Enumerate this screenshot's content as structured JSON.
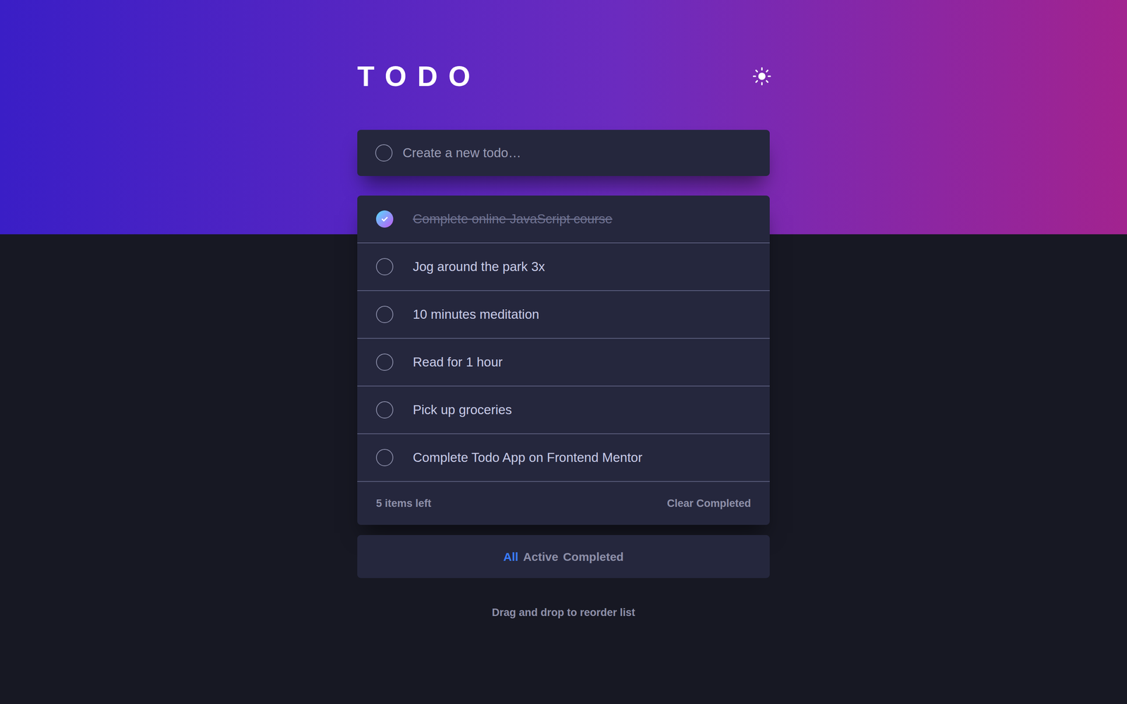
{
  "header": {
    "title": "TODO"
  },
  "new_todo": {
    "placeholder": "Create a new todo…"
  },
  "todos": [
    {
      "text": "Complete online JavaScript course",
      "completed": true
    },
    {
      "text": "Jog around the park 3x",
      "completed": false
    },
    {
      "text": "10 minutes meditation",
      "completed": false
    },
    {
      "text": "Read for 1 hour",
      "completed": false
    },
    {
      "text": "Pick up groceries",
      "completed": false
    },
    {
      "text": "Complete Todo App on Frontend Mentor",
      "completed": false
    }
  ],
  "footer": {
    "count": "5 items left",
    "clear": "Clear Completed"
  },
  "filters": [
    {
      "label": "All",
      "selected": true
    },
    {
      "label": "Active",
      "selected": false
    },
    {
      "label": "Completed",
      "selected": false
    }
  ],
  "hint": "Drag and drop to reorder list"
}
